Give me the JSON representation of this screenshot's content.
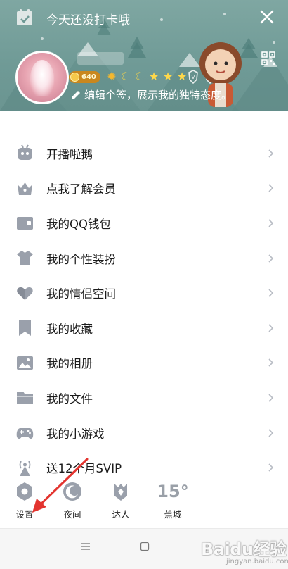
{
  "header": {
    "checkin_text": "今天还没打卡哦",
    "level_number": "640",
    "signature": "编辑个签，展示我的独特态度。",
    "level_icons": [
      "sun-level-icon",
      "moon-level-icon",
      "moon-level-icon",
      "star-level-icon",
      "star-level-icon",
      "star-level-icon"
    ]
  },
  "menu": {
    "items": [
      {
        "label": "开播啦鹅",
        "icon": "robot-tv-icon"
      },
      {
        "label": "点我了解会员",
        "icon": "crown-icon"
      },
      {
        "label": "我的QQ钱包",
        "icon": "wallet-icon"
      },
      {
        "label": "我的个性装扮",
        "icon": "tshirt-icon"
      },
      {
        "label": "我的情侣空间",
        "icon": "heart-icon"
      },
      {
        "label": "我的收藏",
        "icon": "bookmark-icon"
      },
      {
        "label": "我的相册",
        "icon": "image-icon"
      },
      {
        "label": "我的文件",
        "icon": "folder-icon"
      },
      {
        "label": "我的小游戏",
        "icon": "gamepad-icon"
      },
      {
        "label": "送12个月SVIP",
        "icon": "antenna-icon"
      }
    ]
  },
  "toolbar": {
    "settings_label": "设置",
    "night_label": "夜间",
    "expert_label": "达人",
    "weather_temp": "15°",
    "weather_city": "蕉城"
  },
  "watermark": {
    "brand": "Baidu经验",
    "url": "jingyan.baidu.com"
  },
  "colors": {
    "header_bg": "#6f9a96",
    "icon_gray": "#9aa0ab",
    "arrow_red": "#e3342f"
  }
}
